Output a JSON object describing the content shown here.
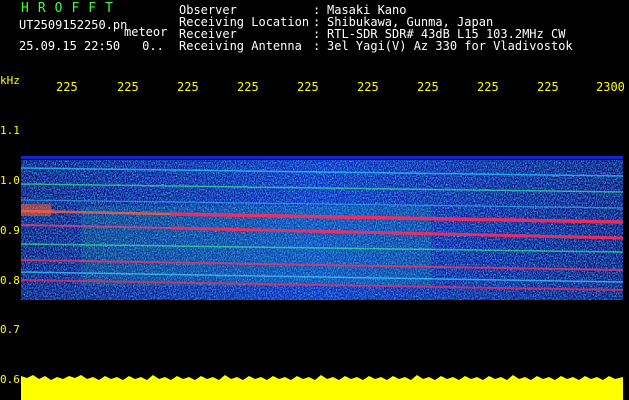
{
  "header": {
    "app_name": "HROFFT",
    "filename": "UT2509152250.pn",
    "mode": "meteor",
    "datetime": "25.09.15 22:50",
    "extra": "0.."
  },
  "info": [
    {
      "key": "Observer",
      "value": "Masaki Kano"
    },
    {
      "key": "Receiving Location",
      "value": "Shibukawa, Gunma, Japan"
    },
    {
      "key": "Receiver",
      "value": "RTL-SDR SDR# 43dB L15 103.2MHz CW"
    },
    {
      "key": "Receiving Antenna",
      "value": "3el Yagi(V) Az 330 for Vladivostok"
    }
  ],
  "colon": ":",
  "axis": {
    "y_unit": "kHz",
    "y_ticks": [
      "1.1",
      "1.0",
      "0.9",
      "0.8",
      "0.7",
      "0.6"
    ],
    "x_ticks": [
      "225",
      "225",
      "225",
      "225",
      "225",
      "225",
      "225",
      "225",
      "225",
      "2300"
    ]
  },
  "colors": {
    "label_green": "#3cff3c",
    "tick_yellow": "#ffff00",
    "background": "#000000",
    "band_red": "#ff2a5a",
    "band_blue": "#1a2aff"
  }
}
